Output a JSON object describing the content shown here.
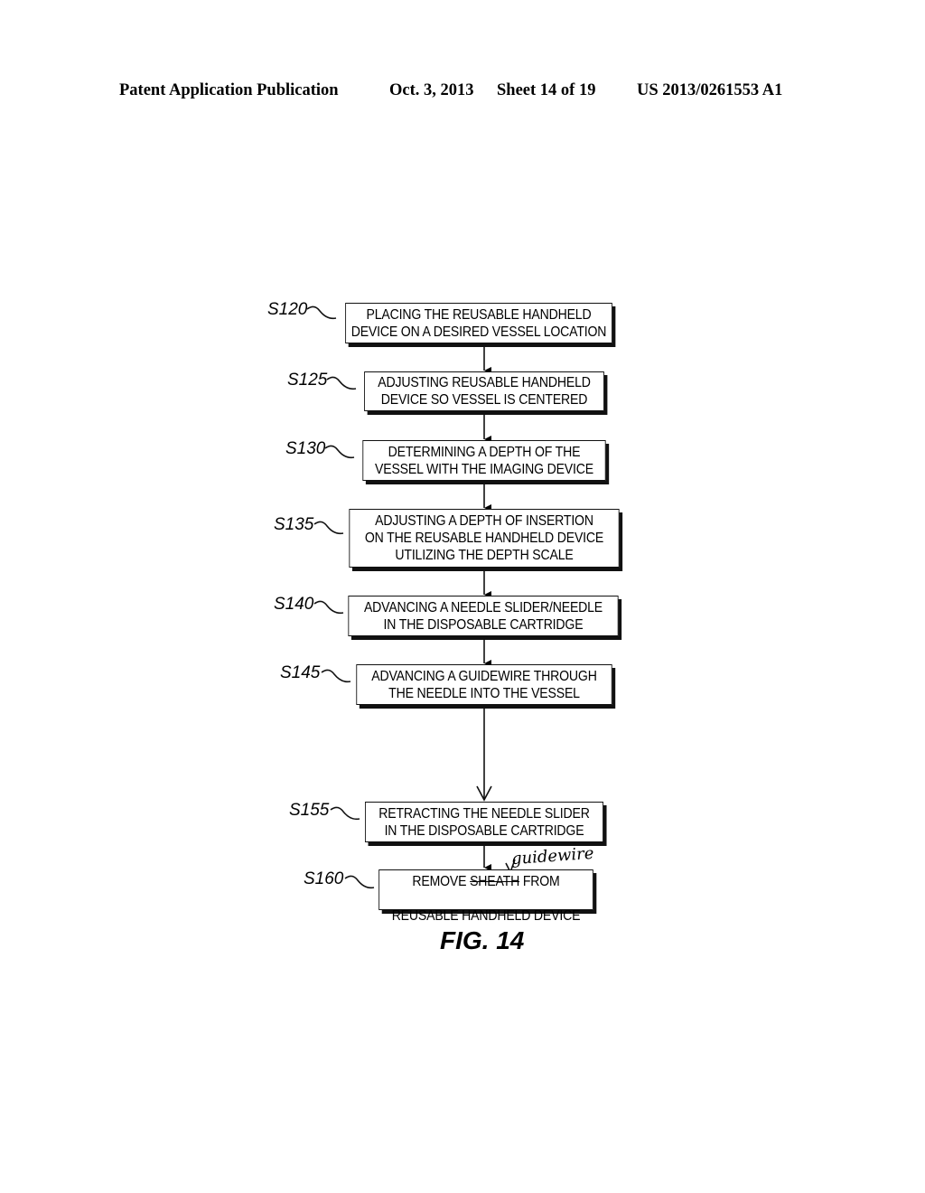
{
  "header": {
    "publication": "Patent Application Publication",
    "date": "Oct. 3, 2013",
    "sheet": "Sheet 14 of 19",
    "number": "US 2013/0261553 A1"
  },
  "steps": [
    {
      "id": "S120",
      "text": "PLACING THE REUSABLE HANDHELD\nDEVICE ON A DESIRED VESSEL LOCATION"
    },
    {
      "id": "S125",
      "text": "ADJUSTING REUSABLE HANDHELD\nDEVICE SO VESSEL IS CENTERED"
    },
    {
      "id": "S130",
      "text": "DETERMINING A DEPTH OF THE\nVESSEL WITH THE IMAGING DEVICE"
    },
    {
      "id": "S135",
      "text": "ADJUSTING A DEPTH OF INSERTION\nON THE REUSABLE HANDHELD DEVICE\nUTILIZING THE DEPTH SCALE"
    },
    {
      "id": "S140",
      "text": "ADVANCING A NEEDLE SLIDER/NEEDLE\nIN THE DISPOSABLE CARTRIDGE"
    },
    {
      "id": "S145",
      "text": "ADVANCING A GUIDEWIRE THROUGH\nTHE NEEDLE INTO THE VESSEL"
    },
    {
      "id": "S155",
      "text": "RETRACTING THE NEEDLE SLIDER\nIN THE DISPOSABLE CARTRIDGE"
    },
    {
      "id": "S160",
      "line1_pre": "REMOVE ",
      "line1_struck": "SHEATH",
      "line1_post": " FROM",
      "line2": "REUSABLE HANDHELD DEVICE",
      "handwritten_correction": "guidewire"
    }
  ],
  "figure_label": "FIG. 14"
}
